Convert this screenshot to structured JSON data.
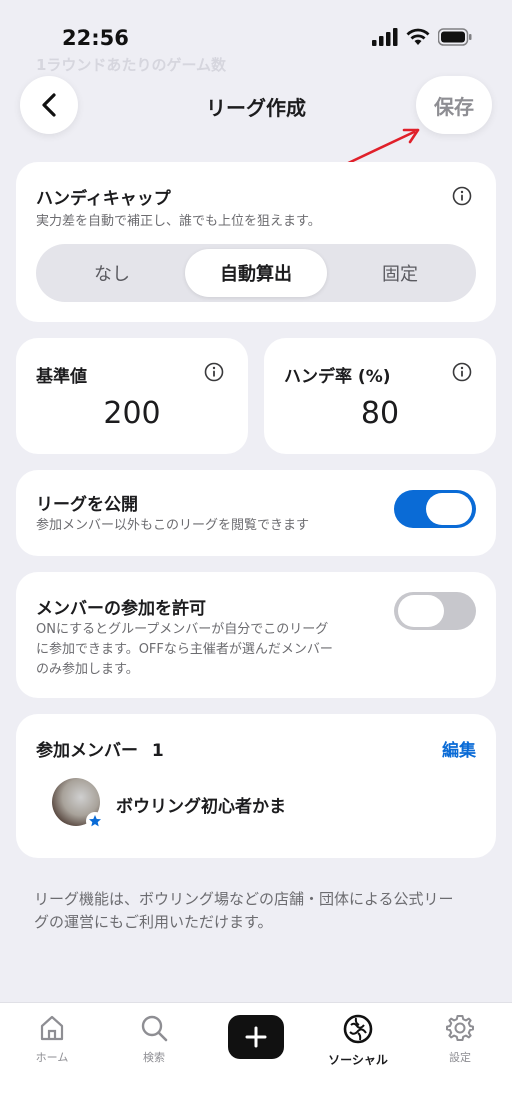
{
  "status": {
    "time": "22:56"
  },
  "faded_header": "1ラウンドあたりのゲーム数",
  "nav": {
    "title": "リーグ作成",
    "save_label": "保存"
  },
  "handicap": {
    "title": "ハンディキャップ",
    "description": "実力差を自動で補正し、誰でも上位を狙えます。",
    "options": [
      "なし",
      "自動算出",
      "固定"
    ],
    "selected": "自動算出"
  },
  "base_value": {
    "label": "基準値",
    "value": "200"
  },
  "handicap_rate": {
    "label": "ハンデ率 (%)",
    "value": "80"
  },
  "publish": {
    "title": "リーグを公開",
    "description": "参加メンバー以外もこのリーグを閲覧できます",
    "enabled": true
  },
  "member_join": {
    "title": "メンバーの参加を許可",
    "description_lines": [
      "ONにするとグループメンバーが自分でこのリーグ",
      "に参加できます。OFFなら主催者が選んだメンバー",
      "のみ参加します。"
    ],
    "enabled": false
  },
  "members": {
    "title": "参加メンバー",
    "count": "1",
    "edit_label": "編集",
    "list": [
      {
        "name": "ボウリング初心者かま"
      }
    ]
  },
  "footnote": {
    "lines": [
      "リーグ機能は、ボウリング場などの店舗・団体による公式リー",
      "グの運営にもご利用いただけます。"
    ]
  },
  "tabs": [
    {
      "label": "ホーム",
      "icon": "home-icon"
    },
    {
      "label": "検索",
      "icon": "search-icon"
    },
    {
      "label": "",
      "icon": "plus-icon"
    },
    {
      "label": "ソーシャル",
      "icon": "social-icon",
      "active": true
    },
    {
      "label": "設定",
      "icon": "gear-icon"
    }
  ],
  "colors": {
    "accent": "#0a6bd6",
    "annotation_arrow": "#e0202a"
  }
}
